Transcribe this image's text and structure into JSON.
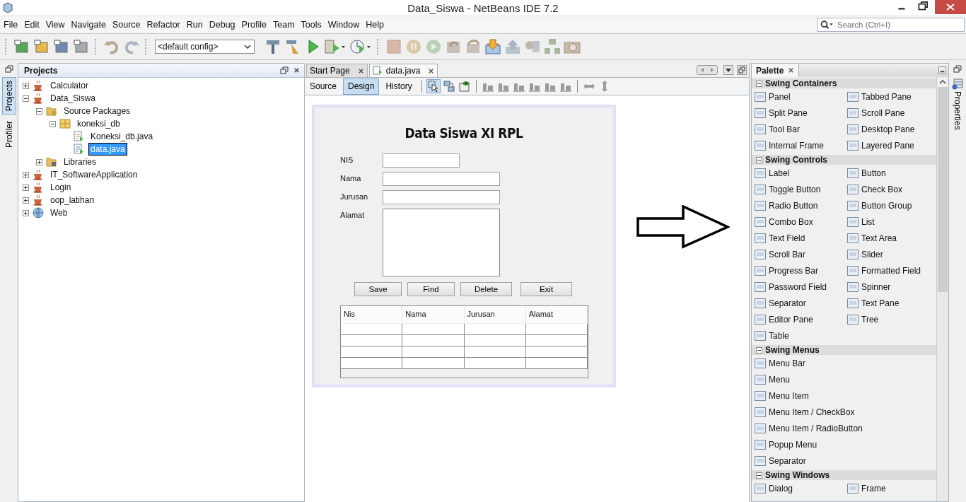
{
  "window": {
    "title": "Data_Siswa - NetBeans IDE 7.2"
  },
  "menu": [
    "File",
    "Edit",
    "View",
    "Navigate",
    "Source",
    "Refactor",
    "Run",
    "Debug",
    "Profile",
    "Team",
    "Tools",
    "Window",
    "Help"
  ],
  "search": {
    "placeholder": "Search (Ctrl+I)"
  },
  "toolbar": {
    "config": "<default config>"
  },
  "side_tabs": [
    {
      "label": "Projects",
      "selected": true
    },
    {
      "label": "Profiler",
      "selected": false
    }
  ],
  "projects": {
    "title": "Projects",
    "tree": [
      {
        "label": "Calculator",
        "kind": "project",
        "expanded": false,
        "selected": false
      },
      {
        "label": "Data_Siswa",
        "kind": "project",
        "expanded": true,
        "selected": false,
        "children": [
          {
            "label": "Source Packages",
            "kind": "sources",
            "expanded": true,
            "selected": false,
            "children": [
              {
                "label": "koneksi_db",
                "kind": "package",
                "expanded": true,
                "selected": false,
                "children": [
                  {
                    "label": "Koneksi_db.java",
                    "kind": "class",
                    "selected": false
                  },
                  {
                    "label": "data.java",
                    "kind": "form",
                    "selected": true
                  }
                ]
              }
            ]
          },
          {
            "label": "Libraries",
            "kind": "library",
            "expanded": false,
            "selected": false
          }
        ]
      },
      {
        "label": "IT_SoftwareApplication",
        "kind": "project",
        "expanded": false,
        "selected": false
      },
      {
        "label": "Login",
        "kind": "project",
        "expanded": false,
        "selected": false
      },
      {
        "label": "oop_latihan",
        "kind": "project",
        "expanded": false,
        "selected": false
      },
      {
        "label": "Web",
        "kind": "web",
        "expanded": false,
        "selected": false
      }
    ]
  },
  "editor_tabs": [
    {
      "label": "Start Page",
      "selected": false
    },
    {
      "label": "data.java",
      "selected": true
    }
  ],
  "view_tabs": [
    {
      "label": "Source",
      "selected": false
    },
    {
      "label": "Design",
      "selected": true
    },
    {
      "label": "History",
      "selected": false
    }
  ],
  "form": {
    "title": "Data Siswa XI RPL",
    "fields": [
      {
        "label": "NIS",
        "kind": "short"
      },
      {
        "label": "Nama",
        "kind": "text"
      },
      {
        "label": "Jurusan",
        "kind": "text"
      },
      {
        "label": "Alamat",
        "kind": "area"
      }
    ],
    "buttons": [
      "Save",
      "Find",
      "Delete",
      "Exit"
    ],
    "table": {
      "columns": [
        "Nis",
        "Nama",
        "Jurusan",
        "Alamat"
      ]
    }
  },
  "palette": {
    "title": "Palette",
    "sections": [
      {
        "title": "Swing Containers",
        "expanded": true,
        "kind": "grid",
        "items": [
          "Panel",
          "Tabbed Pane",
          "Split Pane",
          "Scroll Pane",
          "Tool Bar",
          "Desktop Pane",
          "Internal Frame",
          "Layered Pane"
        ]
      },
      {
        "title": "Swing Controls",
        "expanded": true,
        "kind": "grid",
        "items": [
          "Label",
          "Button",
          "Toggle Button",
          "Check Box",
          "Radio Button",
          "Button Group",
          "Combo Box",
          "List",
          "Text Field",
          "Text Area",
          "Scroll Bar",
          "Slider",
          "Progress Bar",
          "Formatted Field",
          "Password Field",
          "Spinner",
          "Separator",
          "Text Pane",
          "Editor Pane",
          "Tree",
          "Table"
        ]
      },
      {
        "title": "Swing Menus",
        "expanded": true,
        "kind": "list",
        "items": [
          "Menu Bar",
          "Menu",
          "Menu Item",
          "Menu Item / CheckBox",
          "Menu Item / RadioButton",
          "Popup Menu",
          "Separator"
        ]
      },
      {
        "title": "Swing Windows",
        "expanded": true,
        "kind": "grid",
        "items": [
          "Dialog",
          "Frame"
        ]
      }
    ]
  },
  "properties_tab": {
    "label": "Properties"
  }
}
